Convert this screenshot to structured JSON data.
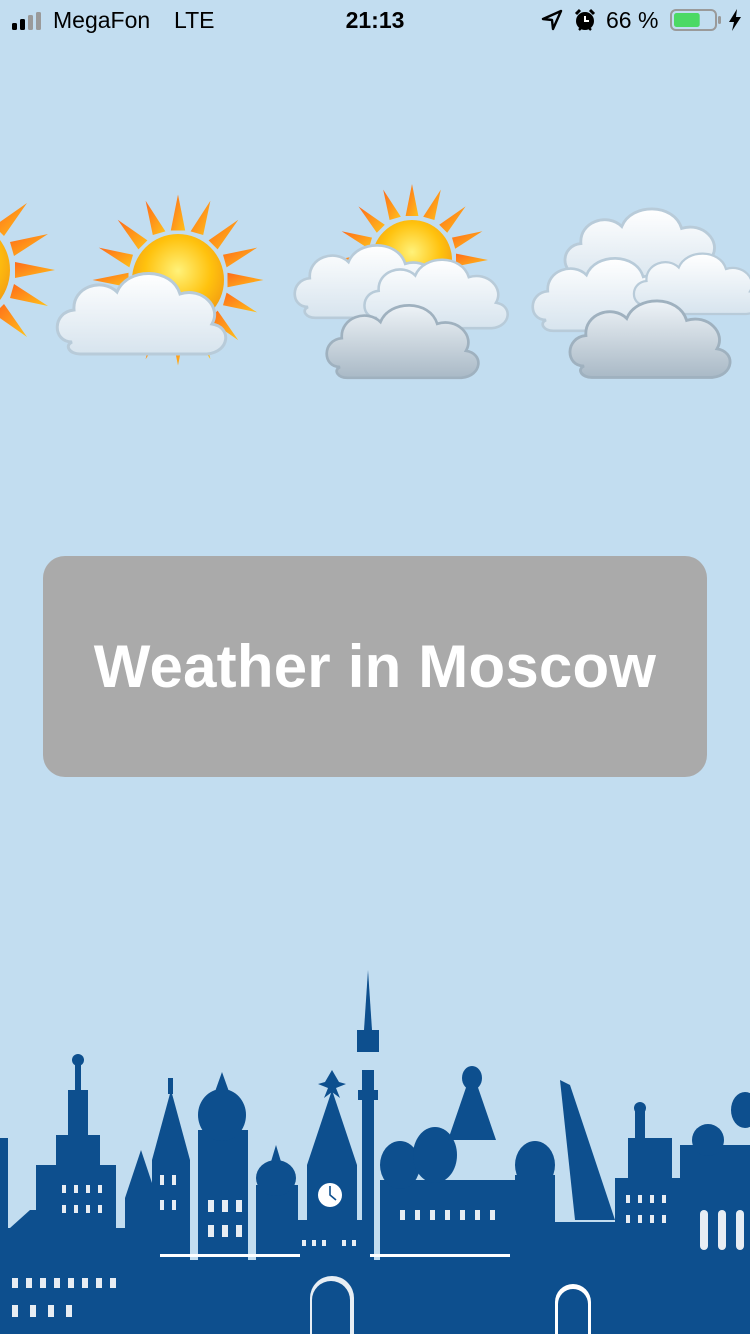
{
  "status_bar": {
    "carrier": "MegaFon",
    "network": "LTE",
    "time": "21:13",
    "battery_percent": "66 %",
    "battery_level": 0.66,
    "icons": [
      "signal-bars-icon",
      "location-arrow-icon",
      "alarm-clock-icon",
      "battery-icon",
      "charging-bolt-icon"
    ]
  },
  "weather_icons": [
    "sun-icon",
    "partly-cloudy-icon",
    "mostly-cloudy-icon",
    "overcast-icon"
  ],
  "main": {
    "title_button": "Weather in Moscow"
  },
  "colors": {
    "background": "#c2ddf0",
    "button": "#aaaaaa",
    "button_text": "#ffffff",
    "skyline": "#0d4f8e",
    "battery": "#4cd964"
  },
  "illustration": "moscow-skyline"
}
